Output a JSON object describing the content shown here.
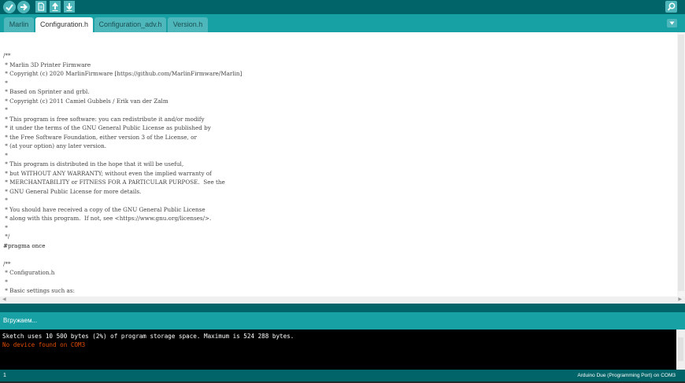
{
  "toolbar": {
    "buttons": [
      {
        "name": "verify",
        "icon": "check-icon"
      },
      {
        "name": "upload",
        "icon": "arrow-right-icon"
      },
      {
        "name": "new",
        "icon": "new-file-icon"
      },
      {
        "name": "open",
        "icon": "open-arrow-up-icon"
      },
      {
        "name": "save",
        "icon": "save-arrow-down-icon"
      }
    ],
    "serial_monitor_icon": "magnifier-icon"
  },
  "tabs": [
    {
      "label": "Marlin",
      "active": false
    },
    {
      "label": "Configuration.h",
      "active": true
    },
    {
      "label": "Configuration_adv.h",
      "active": false
    },
    {
      "label": "Version.h",
      "active": false
    }
  ],
  "tab_menu_icon": "triangle-down-icon",
  "editor": {
    "lines": [
      "/**",
      " * Marlin 3D Printer Firmware",
      " * Copyright (c) 2020 MarlinFirmware [https://github.com/MarlinFirmware/Marlin]",
      " *",
      " * Based on Sprinter and grbl.",
      " * Copyright (c) 2011 Camiel Gubbels / Erik van der Zalm",
      " *",
      " * This program is free software: you can redistribute it and/or modify",
      " * it under the terms of the GNU General Public License as published by",
      " * the Free Software Foundation, either version 3 of the License, or",
      " * (at your option) any later version.",
      " *",
      " * This program is distributed in the hope that it will be useful,",
      " * but WITHOUT ANY WARRANTY; without even the implied warranty of",
      " * MERCHANTABILITY or FITNESS FOR A PARTICULAR PURPOSE.  See the",
      " * GNU General Public License for more details.",
      " *",
      " * You should have received a copy of the GNU General Public License",
      " * along with this program.  If not, see <https://www.gnu.org/licenses/>.",
      " *",
      " */",
      "#pragma once",
      "",
      "/**",
      " * Configuration.h",
      " *",
      " * Basic settings such as:",
      " *"
    ]
  },
  "status": {
    "text": "Вгружаем..."
  },
  "console": {
    "lines": [
      {
        "text": "Sketch uses 10 500 bytes (2%) of program storage space. Maximum is 524 288 bytes.",
        "color": "#ffffff"
      },
      {
        "text": "No device found on COM3",
        "color": "#e34c00"
      }
    ]
  },
  "footer": {
    "line_number": "1",
    "board": "Arduino Due (Programming Port) on COM3"
  },
  "colors": {
    "toolbar_bg": "#006468",
    "tabbar_bg": "#17a1a5",
    "button": "#4db7bb",
    "error": "#e34c00"
  }
}
